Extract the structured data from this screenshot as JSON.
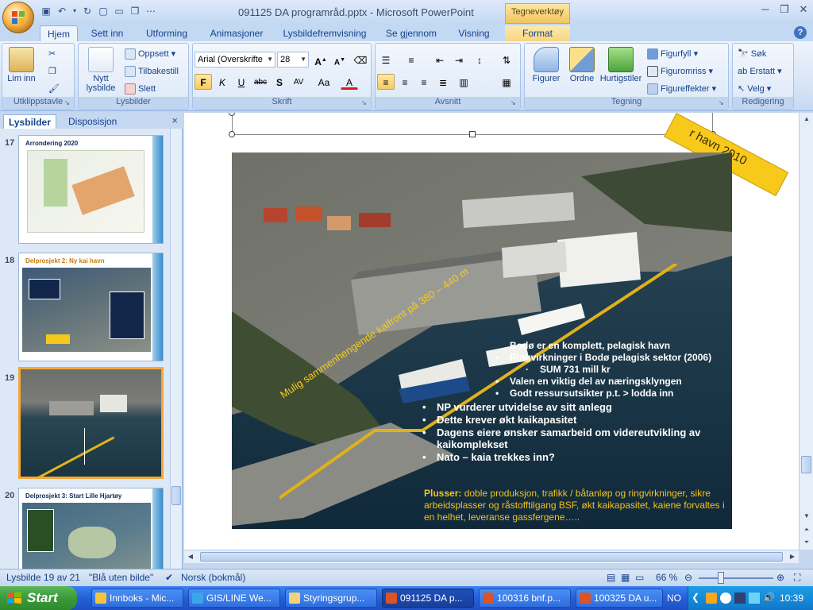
{
  "window": {
    "title": "091125 DA programråd.pptx - Microsoft PowerPoint",
    "context_tab_group": "Tegneverktøy"
  },
  "tabs": [
    "Hjem",
    "Sett inn",
    "Utforming",
    "Animasjoner",
    "Lysbildefremvisning",
    "Se gjennom",
    "Visning",
    "Format"
  ],
  "ribbon": {
    "clipboard": {
      "paste": "Lim inn",
      "label": "Utklippstavle"
    },
    "slides": {
      "new_slide": "Nytt lysbilde",
      "layout": "Oppsett",
      "reset": "Tilbakestill",
      "delete": "Slett",
      "label": "Lysbilder"
    },
    "font": {
      "font_name": "Arial (Overskrifte",
      "font_size": "28",
      "label": "Skrift"
    },
    "paragraph": {
      "label": "Avsnitt"
    },
    "drawing": {
      "shapes": "Figurer",
      "arrange": "Ordne",
      "quick_styles": "Hurtigstiler",
      "fill": "Figurfyll",
      "outline": "Figuromriss",
      "effects": "Figureffekter",
      "label": "Tegning"
    },
    "editing": {
      "find": "Søk",
      "replace": "Erstatt",
      "select": "Velg",
      "label": "Redigering"
    }
  },
  "left_pane": {
    "tabs": [
      "Lysbilder",
      "Disposisjon"
    ],
    "close": "×",
    "slides": [
      {
        "number": "17",
        "title": "Arrondering 2020"
      },
      {
        "number": "18",
        "title": "Delprosjekt 2: Ny kai havn"
      },
      {
        "number": "19",
        "title": ""
      },
      {
        "number": "20",
        "title": "Delprosjekt 3: Start Lille Hjartøy"
      }
    ]
  },
  "slide": {
    "banner": "r havn 2010",
    "quay_label": "Mulig sammenhengende kaifront på 380 – 440 m",
    "bullets": [
      {
        "level": 2,
        "marker": "",
        "text": "Bodø er en komplett, pelagisk havn"
      },
      {
        "level": 2,
        "marker": "•",
        "text": "Ringvirkninger i Bodø pelagisk sektor (2006)"
      },
      {
        "level": 3,
        "marker": "·",
        "text": "SUM 731 mill kr"
      },
      {
        "level": 2,
        "marker": "•",
        "text": "Valen en viktig del av næringsklyngen"
      },
      {
        "level": 2,
        "marker": "•",
        "text": "Godt ressursutsikter p.t. > lodda inn"
      },
      {
        "level": 1,
        "marker": "•",
        "text": "NP vurderer utvidelse av sitt anlegg"
      },
      {
        "level": 1,
        "marker": "•",
        "text": "Dette krever økt kaikapasitet"
      },
      {
        "level": 1,
        "marker": "•",
        "text": "Dagens eiere ønsker samarbeid om videreutvikling av kaikomplekset"
      },
      {
        "level": 1,
        "marker": "•",
        "text": "Nato – kaia trekkes inn?"
      }
    ],
    "plusser_label": "Plusser:",
    "plusser_text": "doble produksjon, trafikk / båtanløp og ringvirkninger, sikre arbeidsplasser og råstofftilgang BSF, økt kaikapasitet, kaiene forvaltes i en helhet, leveranse gassfergene….."
  },
  "status": {
    "slide_pos": "Lysbilde 19 av 21",
    "theme": "\"Blå uten bilde\"",
    "language": "Norsk (bokmål)",
    "zoom": "66 %"
  },
  "taskbar": {
    "start": "Start",
    "items": [
      "Innboks - Mic...",
      "GIS/LINE We...",
      "Styringsgrup...",
      "091125 DA p...",
      "100316 bnf.p...",
      "100325 DA u..."
    ],
    "lang": "NO",
    "clock": "10:39"
  },
  "colors": {
    "accent_yellow": "#f3c21a",
    "ribbon_blue": "#15428b",
    "taskbar_blue": "#2460d8"
  }
}
